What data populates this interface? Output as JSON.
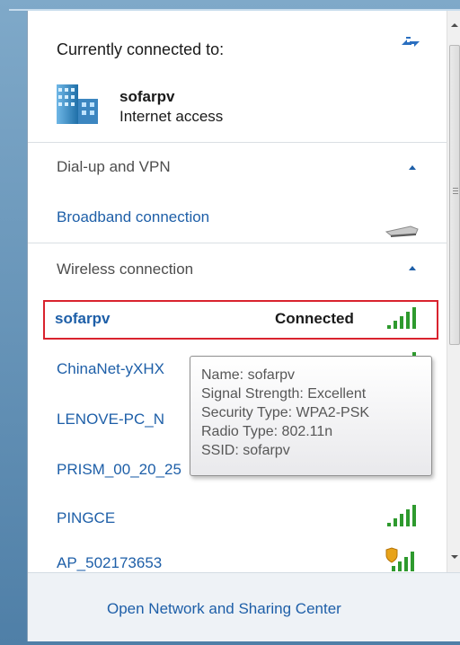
{
  "header": {
    "title": "Currently connected to:",
    "network_name": "sofarpv",
    "network_status": "Internet access",
    "refresh_icon": "refresh-arrows-icon",
    "network_icon": "network-building-icon"
  },
  "sections": {
    "dialup": {
      "label": "Dial-up and VPN"
    },
    "broadband": {
      "label": "Broadband connection",
      "icon": "modem-icon"
    },
    "wireless": {
      "label": "Wireless connection"
    }
  },
  "networks": [
    {
      "name": "sofarpv",
      "status": "Connected",
      "signal_bars": 5,
      "secured": false
    },
    {
      "name": "ChinaNet-yXHX",
      "status": "",
      "signal_bars": 5,
      "secured": false
    },
    {
      "name": "LENOVE-PC_N",
      "status": "",
      "signal_bars": 5,
      "secured": false
    },
    {
      "name": "PRISM_00_20_25",
      "status": "",
      "signal_bars": 5,
      "secured": false
    },
    {
      "name": "PINGCE",
      "status": "",
      "signal_bars": 5,
      "secured": false
    },
    {
      "name": "AP_502173653",
      "status": "",
      "signal_bars": 5,
      "secured": true
    }
  ],
  "tooltip": {
    "name": "Name: sofarpv",
    "signal": "Signal Strength: Excellent",
    "security": "Security Type: WPA2-PSK",
    "radio": "Radio Type: 802.11n",
    "ssid": "SSID: sofarpv"
  },
  "footer": {
    "link": "Open Network and Sharing Center"
  },
  "colors": {
    "link": "#1e5fa8",
    "signal_green": "#2e9a2e",
    "highlight_border": "#d9232e",
    "tooltip_text": "#575757"
  }
}
